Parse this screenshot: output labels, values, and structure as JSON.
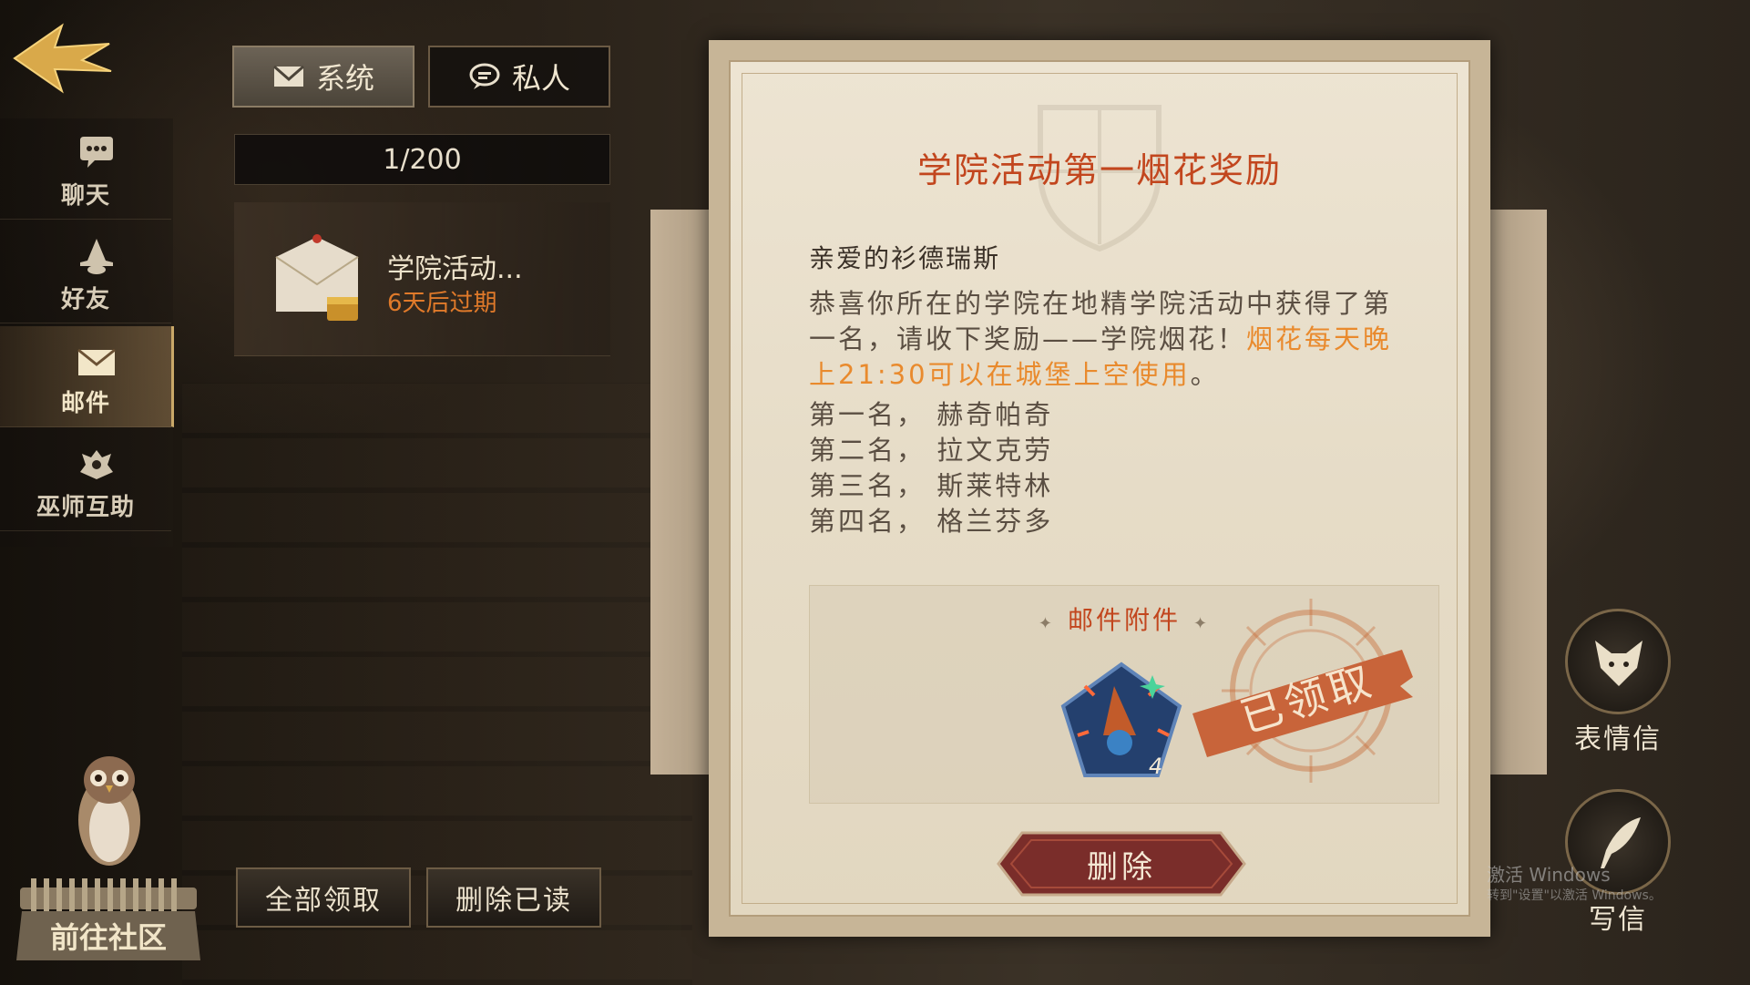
{
  "tabs": {
    "system": "系统",
    "private": "私人"
  },
  "sidebar": {
    "items": [
      {
        "label": "聊天",
        "icon": "chat-bubble-icon"
      },
      {
        "label": "好友",
        "icon": "wizard-hat-icon"
      },
      {
        "label": "邮件",
        "icon": "envelope-icon"
      },
      {
        "label": "巫师互助",
        "icon": "helping-hands-icon"
      }
    ],
    "active_index": 2
  },
  "mail_list": {
    "count": "1/200",
    "items": [
      {
        "title": "学院活动...",
        "expiry": "6天后过期"
      }
    ]
  },
  "mail": {
    "title": "学院活动第一烟花奖励",
    "greeting": "亲爱的衫德瑞斯",
    "body_plain": "恭喜你所在的学院在地精学院活动中获得了第一名，请收下奖励——学院烟花！",
    "body_highlight": "烟花每天晚上21:30可以在城堡上空使用",
    "body_end": "。",
    "rankings": [
      "第一名，  赫奇帕奇",
      "第二名，  拉文克劳",
      "第三名，  斯莱特林",
      "第四名，  格兰芬多"
    ],
    "attachment_title": "邮件附件",
    "attachment_item": {
      "icon": "firework-wizard-icon",
      "quantity": "4"
    },
    "claimed_stamp": "已领取",
    "delete_label": "删除"
  },
  "actions": {
    "claim_all": "全部领取",
    "delete_read": "删除已读",
    "community": "前往社区",
    "emoji_letter": "表情信",
    "write_letter": "写信"
  },
  "watermark": {
    "line1": "激活 Windows",
    "line2": "转到\"设置\"以激活 Windows。"
  },
  "colors": {
    "accent_orange": "#e98a2d",
    "title_red": "#c2461e",
    "gold": "#c9a868"
  }
}
